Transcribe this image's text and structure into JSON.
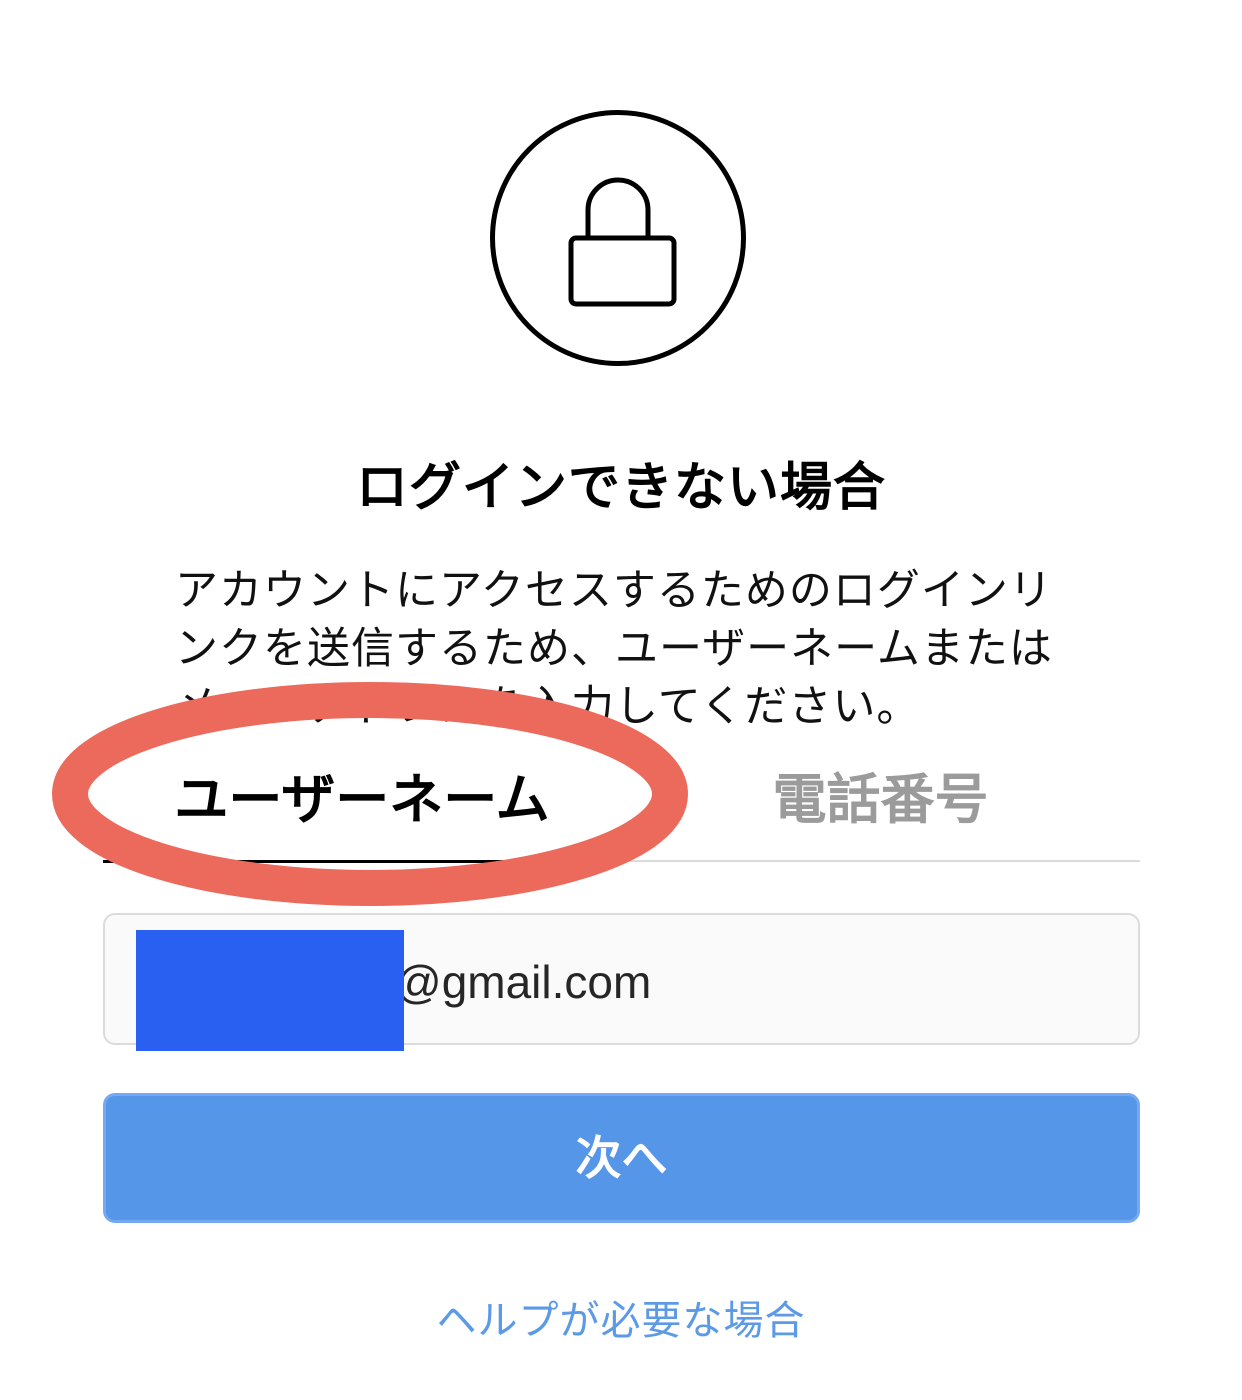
{
  "header": {
    "icon": "lock-icon",
    "title": "ログインできない場合"
  },
  "description": {
    "line1": "アカウントにアクセスするためのログインリ",
    "line2": "ンクを送信するため、ユーザーネームまたは",
    "line3": "メールアドレスを入力してください。"
  },
  "tabs": [
    {
      "label": "ユーザーネーム",
      "active": true
    },
    {
      "label": "電話番号",
      "active": false
    }
  ],
  "input": {
    "value": "@gmail.com",
    "redacted": true
  },
  "next_button": {
    "label": "次へ"
  },
  "help_link": {
    "label": "ヘルプが必要な場合"
  },
  "colors": {
    "annotation": "#ec6a5c",
    "button": "#5596e8",
    "link": "#5d9ae6",
    "redaction": "#2a60f2"
  }
}
